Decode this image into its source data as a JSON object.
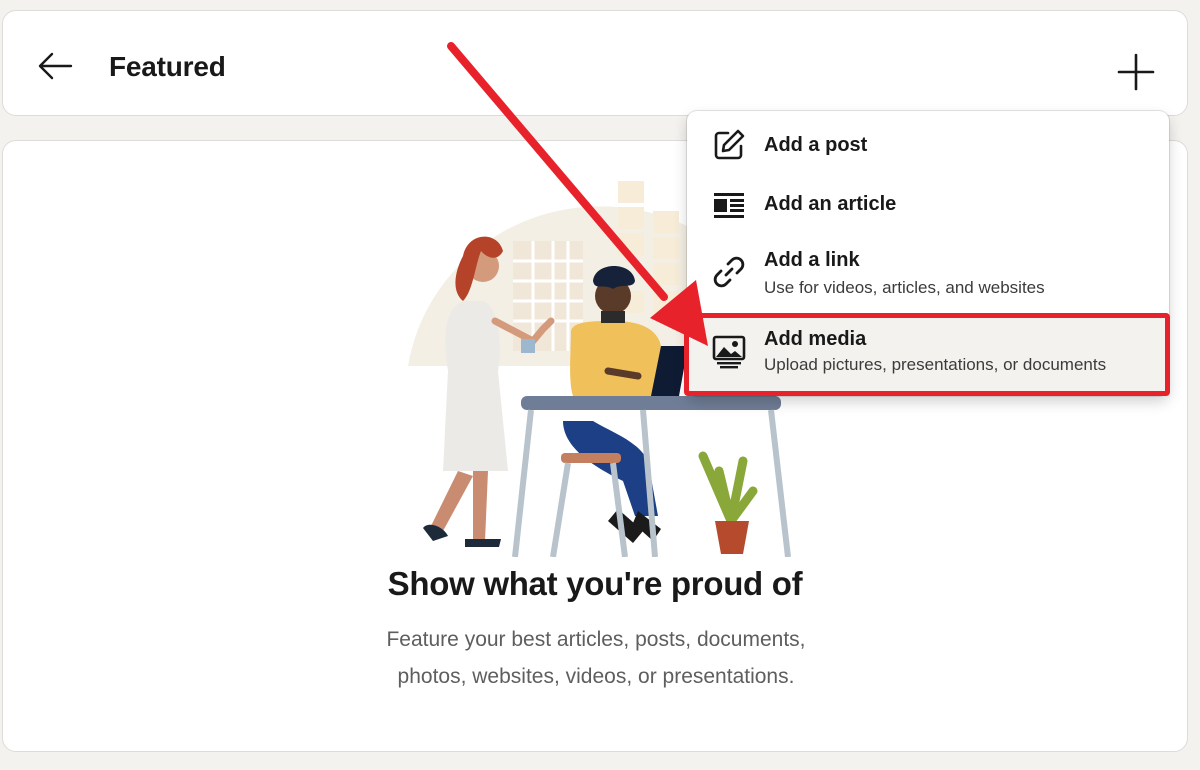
{
  "header": {
    "title": "Featured",
    "back_icon": "arrow-left-icon",
    "add_icon": "plus-icon"
  },
  "menu": {
    "items": [
      {
        "label": "Add a post",
        "sublabel": "",
        "icon": "pencil-square-icon"
      },
      {
        "label": "Add an article",
        "sublabel": "",
        "icon": "article-icon"
      },
      {
        "label": "Add a link",
        "sublabel": "Use for videos, articles, and websites",
        "icon": "link-icon"
      },
      {
        "label": "Add media",
        "sublabel": "Upload pictures, presentations, or documents",
        "icon": "image-stack-icon"
      }
    ]
  },
  "empty_state": {
    "title": "Show what you're proud of",
    "description": "Feature your best articles, posts, documents, photos, websites, videos, or presentations."
  },
  "annotation": {
    "color": "#e8222a"
  },
  "colors": {
    "background": "#f4f2ee",
    "card": "#ffffff",
    "hover_row": "#f3f2ef"
  }
}
